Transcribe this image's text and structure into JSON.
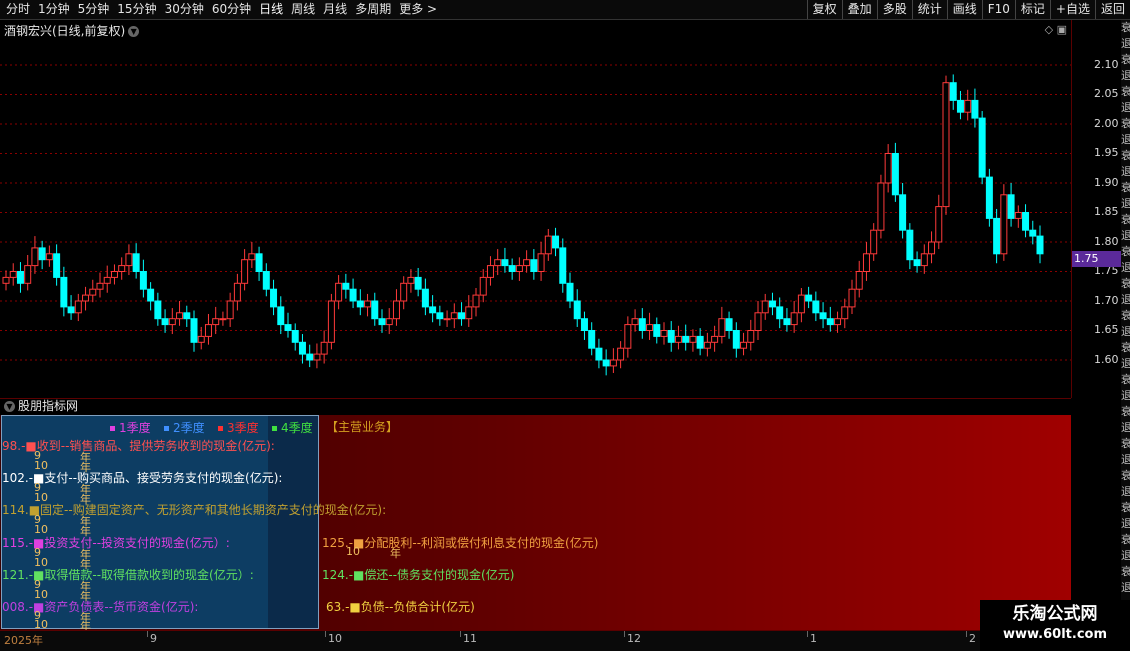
{
  "toolbar": {
    "periods": [
      "分时",
      "1分钟",
      "5分钟",
      "15分钟",
      "30分钟",
      "60分钟",
      "日线",
      "周线",
      "月线",
      "多周期",
      "更多 >"
    ],
    "active_period": "日线",
    "buttons": [
      "复权",
      "叠加",
      "多股",
      "统计",
      "画线",
      "F10",
      "标记",
      "+自选",
      "返回"
    ]
  },
  "chart": {
    "title": "酒钢宏兴(日线,前复权)",
    "price_labels": [
      "2.10",
      "2.05",
      "2.00",
      "1.95",
      "1.90",
      "1.85",
      "1.80",
      "1.75",
      "1.70",
      "1.65",
      "1.60"
    ],
    "current_price": "1.75"
  },
  "indicator": {
    "title": "股朋指标网",
    "quarters": [
      {
        "label": "1季度",
        "color": "#e040e0"
      },
      {
        "label": "2季度",
        "color": "#4090ff"
      },
      {
        "label": "3季度",
        "color": "#ff3030"
      },
      {
        "label": "4季度",
        "color": "#40e040"
      }
    ],
    "main_business": "【主营业务】",
    "left_lines": [
      {
        "text": "98.-■收到--销售商品、提供劳务收到的现金(亿元):",
        "color": "#ff5050"
      },
      {
        "text": "102.-■支付--购买商品、接受劳务支付的现金(亿元):",
        "color": "#ffffff"
      },
      {
        "text": "114.■固定--购建固定资产、无形资产和其他长期资产支付的现金(亿元):",
        "color": "#c0a030"
      },
      {
        "text": "115.-■投资支付--投资支付的现金(亿元）:",
        "color": "#e040e0"
      },
      {
        "text": "121.-■取得借款--取得借款收到的现金(亿元）:",
        "color": "#60e060"
      },
      {
        "text": "008.-■资产负债表--货币资金(亿元):",
        "color": "#c040e0"
      }
    ],
    "right_lines": [
      {
        "text": "125.-■分配股利--利润或偿付利息支付的现金(亿元)",
        "color": "#f0a040"
      },
      {
        "text": "124.-■偿还--债务支付的现金(亿元)",
        "color": "#60e060"
      },
      {
        "text": "63.-■负债--负债合计(亿元)",
        "color": "#f0d040"
      }
    ],
    "sub_labels": {
      "nine": "9",
      "ten": "10",
      "nian": "年"
    }
  },
  "date_axis": {
    "labels": [
      "2025年",
      "9",
      "10",
      "11",
      "12",
      "1",
      "2"
    ]
  },
  "watermark": {
    "title": "乐淘公式网",
    "url": "www.60lt.com"
  },
  "side_strip": "衰退衰退衰退衰退衰退衰退衰退衰退衰退衰退衰退衰退衰退衰退衰退衰退衰退衰退",
  "colors": {
    "up": "#ff3a3a",
    "down": "#00ffff",
    "grid": "#8a0000"
  }
}
